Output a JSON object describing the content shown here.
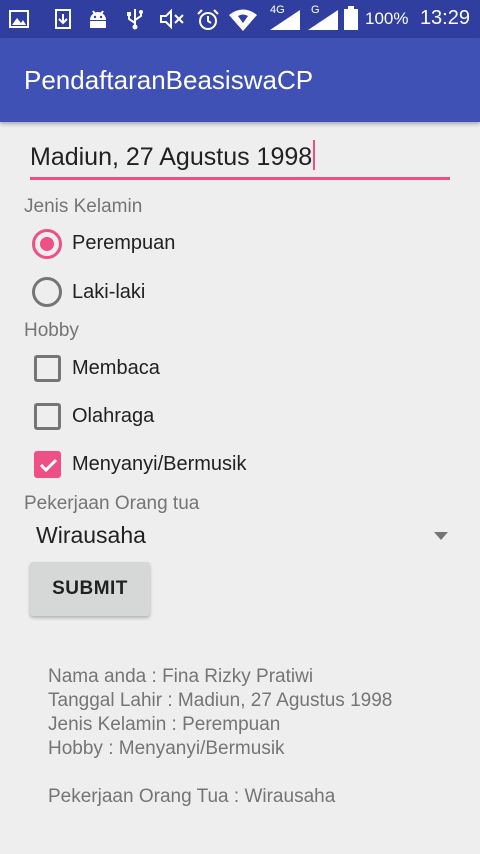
{
  "status_bar": {
    "icons": [
      "image-icon",
      "download-icon",
      "android-icon",
      "usb-icon",
      "mute-icon",
      "alarm-icon",
      "wifi-icon",
      "signal-4g-icon",
      "signal-g-icon",
      "battery-icon"
    ],
    "net_4g": "4G",
    "net_g": "G",
    "battery": "100%",
    "time": "13:29"
  },
  "app_bar": {
    "title": "PendaftaranBeasiswaCP"
  },
  "form": {
    "birth_field": {
      "value": "Madiun, 27 Agustus 1998"
    },
    "gender": {
      "label": "Jenis Kelamin",
      "options": [
        {
          "label": "Perempuan",
          "checked": true
        },
        {
          "label": "Laki-laki",
          "checked": false
        }
      ]
    },
    "hobby": {
      "label": "Hobby",
      "options": [
        {
          "label": "Membaca",
          "checked": false
        },
        {
          "label": "Olahraga",
          "checked": false
        },
        {
          "label": "Menyanyi/Bermusik",
          "checked": true
        }
      ]
    },
    "occupation": {
      "label": "Pekerjaan Orang tua",
      "selected": "Wirausaha"
    },
    "submit_label": "SUBMIT"
  },
  "result": {
    "name": "Nama anda : Fina Rizky Pratiwi",
    "birth": "Tanggal Lahir : Madiun, 27 Agustus 1998",
    "gender": "Jenis Kelamin : Perempuan",
    "hobby": "Hobby : Menyanyi/Bermusik",
    "occupation": "Pekerjaan Orang Tua : Wirausaha"
  },
  "colors": {
    "status_bar": "#303f9f",
    "app_bar": "#3f51b5",
    "accent": "#ee4f85",
    "background": "#eeeeee"
  }
}
